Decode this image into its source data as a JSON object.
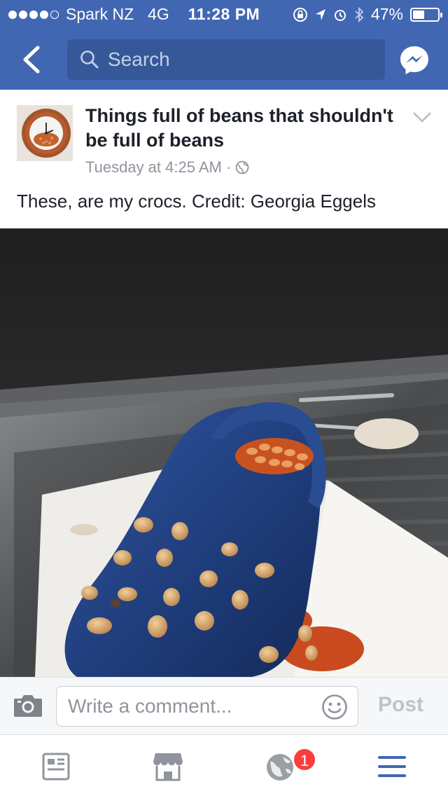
{
  "status_bar": {
    "carrier": "Spark NZ",
    "network": "4G",
    "time": "11:28 PM",
    "battery": "47%",
    "battery_level": 0.47,
    "signal_bars": 4
  },
  "nav": {
    "search_placeholder": "Search",
    "icons": [
      "back-chevron-icon",
      "search-icon",
      "messenger-icon"
    ]
  },
  "post": {
    "page_name": "Things full of beans that shouldn't be full of beans",
    "timestamp": "Tuesday at 4:25 AM",
    "separator": "·",
    "privacy_icon": "globe-icon",
    "text": "These, are my crocs. Credit: Georgia Eggels"
  },
  "comment": {
    "placeholder": "Write a comment...",
    "post_label": "Post",
    "icons": [
      "camera-icon",
      "smiley-icon"
    ]
  },
  "tabbar": {
    "items": [
      "news-feed-icon",
      "marketplace-icon",
      "notifications-globe-icon",
      "menu-icon"
    ],
    "notification_count": "1"
  },
  "colors": {
    "facebook_blue": "#4267b2",
    "search_bg": "#365899",
    "badge_red": "#fa3e3e",
    "tab_icon_gray": "#90949c",
    "menu_blue": "#4267b2"
  }
}
